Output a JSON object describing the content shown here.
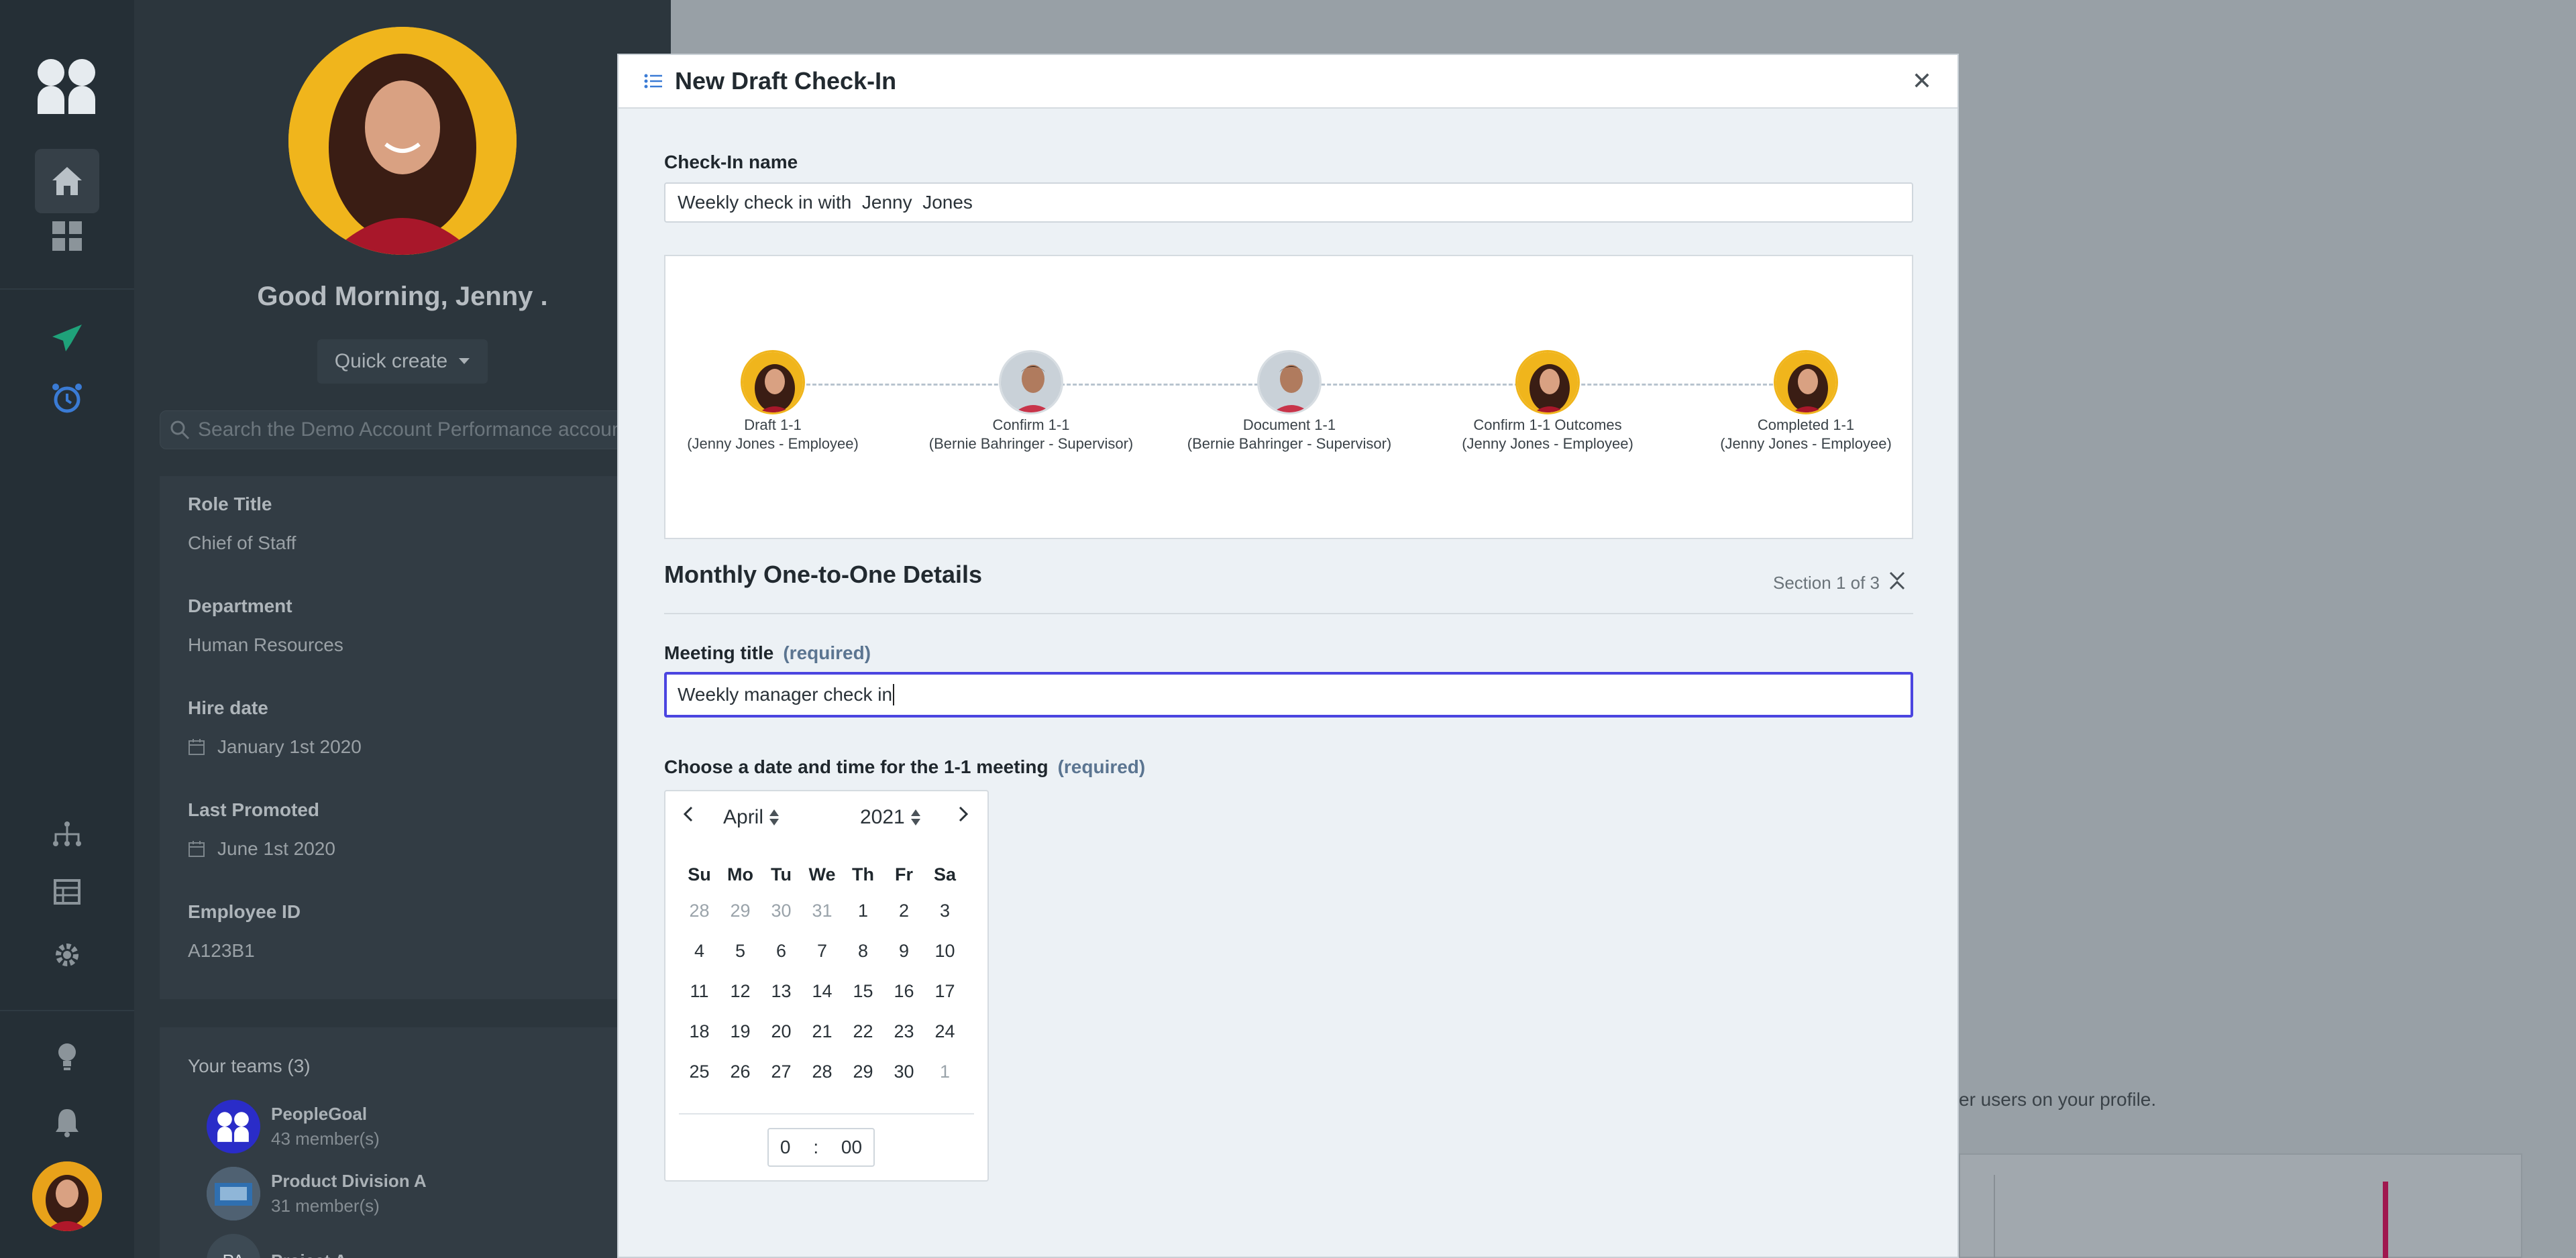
{
  "rail": {
    "icons": [
      "app-logo",
      "home-icon",
      "dashboard-icon",
      "send-icon",
      "alarm-icon",
      "org-chart-icon",
      "table-icon",
      "gear-icon",
      "lightbulb-icon",
      "bell-icon"
    ]
  },
  "profile": {
    "greeting": "Good Morning, Jenny .",
    "quick_create": "Quick create",
    "search_placeholder": "Search the Demo Account Performance account",
    "fields": [
      {
        "label": "Role Title",
        "value": "Chief of Staff"
      },
      {
        "label": "Department",
        "value": "Human Resources"
      },
      {
        "label": "Hire date",
        "value": "January 1st 2020"
      },
      {
        "label": "Last Promoted",
        "value": "June 1st 2020"
      },
      {
        "label": "Employee ID",
        "value": "A123B1"
      }
    ],
    "teams_title": "Your teams (3)",
    "teams": [
      {
        "name": "PeopleGoal",
        "members": "43 member(s)"
      },
      {
        "name": "Product Division A",
        "members": "31 member(s)"
      },
      {
        "name": "Project A",
        "initials": "PA"
      }
    ]
  },
  "modal": {
    "title": "New Draft Check-In",
    "checkin_label": "Check-In name",
    "checkin_value": "Weekly check in with  Jenny  Jones",
    "workflow": [
      {
        "title": "Draft 1-1",
        "who": "(Jenny Jones - Employee)",
        "avatar": "jenny"
      },
      {
        "title": "Confirm 1-1",
        "who": "(Bernie Bahringer - Supervisor)",
        "avatar": "bernie"
      },
      {
        "title": "Document 1-1",
        "who": "(Bernie Bahringer - Supervisor)",
        "avatar": "bernie"
      },
      {
        "title": "Confirm 1-1 Outcomes",
        "who": "(Jenny Jones - Employee)",
        "avatar": "jenny"
      },
      {
        "title": "Completed 1-1",
        "who": "(Jenny Jones - Employee)",
        "avatar": "jenny"
      }
    ],
    "section_title": "Monthly One-to-One Details",
    "section_counter": "Section 1 of 3",
    "meeting_label": "Meeting title",
    "required": "(required)",
    "meeting_value": "Weekly manager check in",
    "date_label": "Choose a date and time for the 1-1 meeting",
    "calendar": {
      "month": "April",
      "year": "2021",
      "weekdays": [
        "Su",
        "Mo",
        "Tu",
        "We",
        "Th",
        "Fr",
        "Sa"
      ],
      "weeks": [
        [
          "28",
          "29",
          "30",
          "31",
          "1",
          "2",
          "3"
        ],
        [
          "4",
          "5",
          "6",
          "7",
          "8",
          "9",
          "10"
        ],
        [
          "11",
          "12",
          "13",
          "14",
          "15",
          "16",
          "17"
        ],
        [
          "18",
          "19",
          "20",
          "21",
          "22",
          "23",
          "24"
        ],
        [
          "25",
          "26",
          "27",
          "28",
          "29",
          "30",
          "1"
        ]
      ],
      "hour": "0",
      "minute": "00"
    }
  },
  "background": {
    "text": "er users on your profile."
  }
}
